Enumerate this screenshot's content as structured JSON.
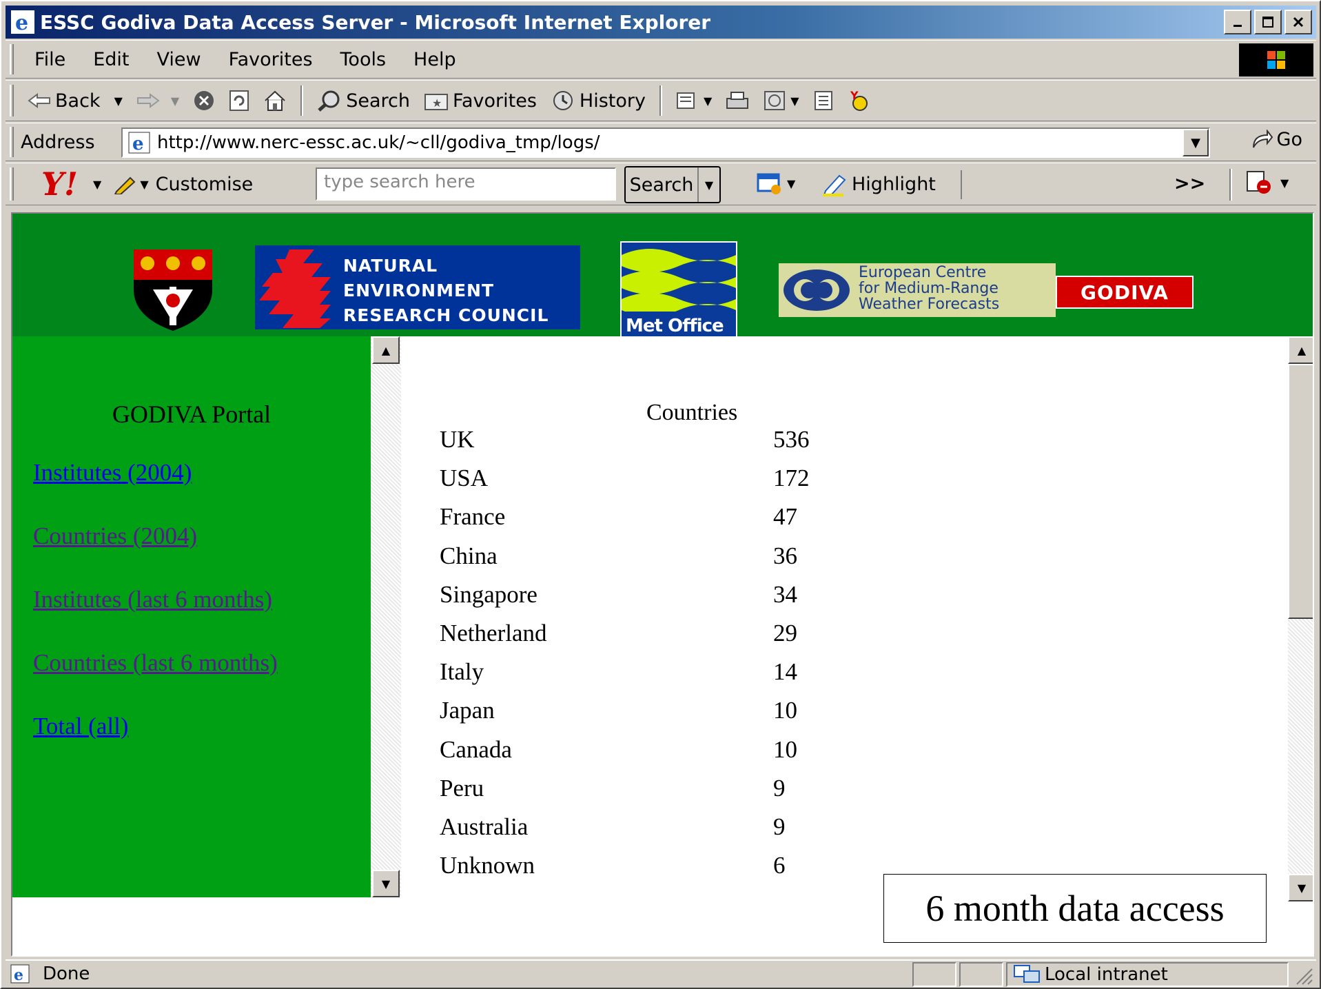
{
  "window": {
    "title": "ESSC Godiva Data Access Server - Microsoft Internet Explorer"
  },
  "menu": {
    "items": [
      "File",
      "Edit",
      "View",
      "Favorites",
      "Tools",
      "Help"
    ]
  },
  "toolbar": {
    "back": "Back",
    "search": "Search",
    "favorites": "Favorites",
    "history": "History"
  },
  "address": {
    "label": "Address",
    "url": "http://www.nerc-essc.ac.uk/~cll/godiva_tmp/logs/",
    "go": "Go"
  },
  "yahoo": {
    "logo": "Y!",
    "customise": "Customise",
    "search_placeholder": "type search here",
    "search_button": "Search",
    "highlight": "Highlight",
    "more": ">>"
  },
  "banner": {
    "nerc_lines": [
      "NATURAL",
      "ENVIRONMENT",
      "RESEARCH COUNCIL"
    ],
    "metoffice": "Met Office",
    "ecmwf_lines": [
      "European Centre",
      "for Medium-Range",
      "Weather Forecasts"
    ],
    "godiva": "GODIVA"
  },
  "nav": {
    "title": "GODIVA Portal",
    "links": [
      {
        "label": "Institutes (2004)",
        "color": "#0000ee"
      },
      {
        "label": "Countries (2004)",
        "color": "#551a8b"
      },
      {
        "label": "Institutes (last 6 months)",
        "color": "#551a8b"
      },
      {
        "label": "Countries (last 6 months)",
        "color": "#551a8b"
      },
      {
        "label": "Total (all)",
        "color": "#0000ee"
      }
    ]
  },
  "table": {
    "header": "Countries",
    "rows": [
      {
        "country": "UK",
        "count": "536"
      },
      {
        "country": "USA",
        "count": "172"
      },
      {
        "country": "France",
        "count": "47"
      },
      {
        "country": "China",
        "count": "36"
      },
      {
        "country": "Singapore",
        "count": "34"
      },
      {
        "country": "Netherland",
        "count": "29"
      },
      {
        "country": "Italy",
        "count": "14"
      },
      {
        "country": "Japan",
        "count": "10"
      },
      {
        "country": "Canada",
        "count": "10"
      },
      {
        "country": "Peru",
        "count": "9"
      },
      {
        "country": "Australia",
        "count": "9"
      },
      {
        "country": "Unknown",
        "count": "6"
      }
    ]
  },
  "caption": "6 month data access",
  "status": {
    "text": "Done",
    "zone": "Local intranet"
  },
  "colors": {
    "banner_green": "#00861b",
    "nav_green": "#00a014",
    "nerc_blue": "#003399",
    "godiva_red": "#d40000"
  }
}
